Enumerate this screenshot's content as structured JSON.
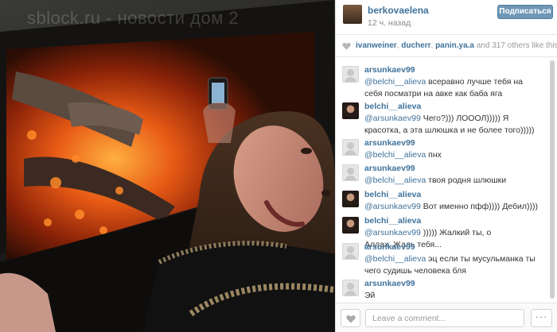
{
  "photo": {
    "watermark": "sblock.ru - новости дом 2"
  },
  "post": {
    "username": "berkovaelena",
    "time_ago": "12 ч. назад",
    "follow_label": "Подписаться"
  },
  "likes": {
    "user1": "ivanweiner",
    "sep1": ", ",
    "user2": "ducherr",
    "sep2": ", ",
    "user3": "panin.ya.a",
    "and": " and ",
    "count": "317",
    "suffix": " others like this."
  },
  "comments": [
    {
      "user": "arsunkaev99",
      "mention": "@belchi__alieva",
      "text": " всеравно лучше тебя на себя посматри на авке как баба яга",
      "avatar": "grey"
    },
    {
      "user": "belchi__alieva",
      "mention": "@arsunkaev99",
      "text": " Чего?))) ЛОООЛ))))) Я красотка, а эта шлюшка и не более того)))))",
      "avatar": "photo"
    },
    {
      "user": "arsunkaev99",
      "mention": "@belchi__alieva",
      "text": " пнх",
      "avatar": "grey"
    },
    {
      "user": "arsunkaev99",
      "mention": "@belchi__alieva",
      "text": " твоя родня шлюшки",
      "avatar": "grey"
    },
    {
      "user": "belchi__alieva",
      "mention": "@arsunkaev99",
      "text": " Вот именно пфф)))) Дебил))))",
      "avatar": "photo"
    },
    {
      "user": "belchi__alieva",
      "mention": "@arsunkaev99",
      "text": " ))))) Жалкий ты, о Аллах..Жаль тебя...",
      "avatar": "photo"
    },
    {
      "user": "arsunkaev99",
      "mention": "@belchi__alieva",
      "text": " эц если ты мусульманка ты чего судишь человека бля",
      "avatar": "grey"
    },
    {
      "user": "arsunkaev99",
      "mention": "",
      "text": "Эй",
      "avatar": "grey"
    }
  ],
  "footer": {
    "comment_placeholder": "Leave a comment...",
    "more_label": "···"
  },
  "colors": {
    "link": "#3f729b",
    "follow_bg": "#6f97b6"
  }
}
